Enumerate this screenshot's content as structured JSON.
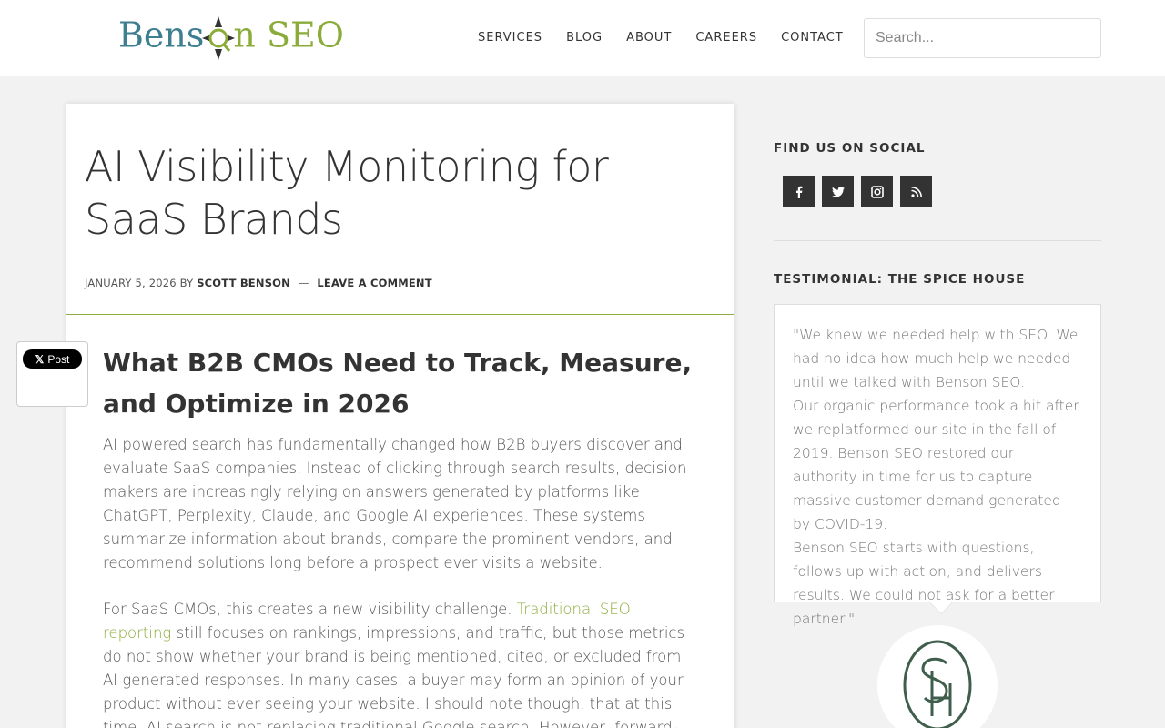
{
  "header": {
    "logo_left": "Bens",
    "logo_right": "n SEO",
    "nav": [
      "SERVICES",
      "BLOG",
      "ABOUT",
      "CAREERS",
      "CONTACT"
    ],
    "search_placeholder": "Search..."
  },
  "share": {
    "x_post_label": "Post",
    "x_icon": "x-logo"
  },
  "article": {
    "title": "AI Visibility Monitoring for SaaS Brands",
    "meta": {
      "date": "JANUARY 5, 2026",
      "by": "BY",
      "author": "SCOTT BENSON",
      "separator": "—",
      "comment_link": "LEAVE A COMMENT"
    },
    "subheading": "What B2B CMOs Need to Track, Measure, and Optimize in 2026",
    "paragraph1": "AI powered search has fundamentally changed how B2B buyers discover and evaluate SaaS companies. Instead of clicking through search results, decision makers are increasingly relying on answers generated by platforms like ChatGPT, Perplexity, Claude, and Google AI experiences. These systems summarize information about brands, compare the prominent vendors, and recommend solutions long before a prospect ever visits a website.",
    "paragraph2_before": "For SaaS CMOs, this creates a new visibility challenge. ",
    "paragraph2_link": "Traditional SEO reporting",
    "paragraph2_after": " still focuses on rankings, impressions, and traffic, but those metrics do not show whether your brand is being mentioned, cited, or excluded from AI generated responses. In many cases, a buyer may form an opinion of your product without ever seeing your website. I should note though, that at this time, AI search is not replacing traditional Google search. However, forward-thinking brands should investigate AI visibility data for"
  },
  "sidebar": {
    "social_title": "FIND US ON SOCIAL",
    "social_icons": [
      "facebook-icon",
      "twitter-icon",
      "instagram-icon",
      "rss-icon"
    ],
    "testimonial_title": "TESTIMONIAL: THE SPICE HOUSE",
    "testimonial_text": "\"We knew we needed help with SEO. We had no idea how much help we needed until we talked with Benson SEO.\nOur organic performance took a hit after we replatformed our site in the fall of 2019. Benson SEO restored our authority in time for us to capture massive customer demand generated by COVID-19.\nBenson SEO starts with questions, follows up with action, and delivers results. We could not ask for a better partner.\""
  },
  "colors": {
    "brand_blue": "#3d7e91",
    "brand_green": "#8bac3b",
    "dark": "#333333",
    "background": "#f2f2f2"
  }
}
